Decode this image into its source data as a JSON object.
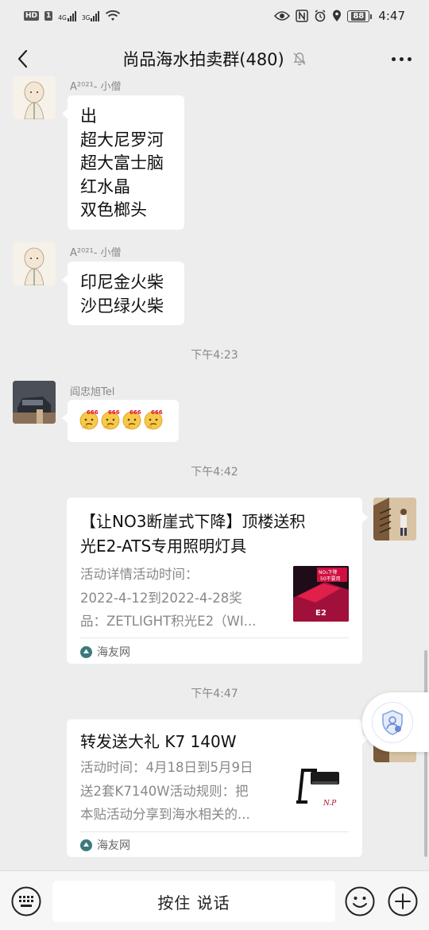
{
  "status_bar": {
    "left_badges": [
      "HD",
      "1"
    ],
    "signal1": "4G",
    "signal2": "3G",
    "battery": "88",
    "time": "4:47"
  },
  "header": {
    "title": "尚品海水拍卖群(480)",
    "back_icon": "chevron-left-icon",
    "mute_icon": "bell-muted-icon",
    "more_icon": "more-dots-icon"
  },
  "messages": [
    {
      "sender": "A²⁰²¹- 小僧",
      "lines": [
        "出",
        "超大尼罗河",
        "超大富士脑",
        "红水晶",
        "双色榔头"
      ]
    },
    {
      "sender": "A²⁰²¹- 小僧",
      "lines": [
        "印尼金火柴",
        "沙巴绿火柴"
      ]
    },
    {
      "timestamp": "下午4:23"
    },
    {
      "sender": "阎忠旭Tel",
      "emoji_text": [
        "666",
        "666",
        "666",
        "666"
      ]
    },
    {
      "timestamp": "下午4:42"
    },
    {
      "card": {
        "title_lines": [
          "【让NO3断崖式下降】顶楼送积",
          "光E2-ATS专用照明灯具"
        ],
        "desc_lines": [
          "活动详情活动时间：",
          "2022-4-12到2022-4-28奖",
          "品：ZETLIGHT积光E2（WI..."
        ],
        "thumb_text": [
          "NO₃下降",
          "50不要用",
          "E2"
        ],
        "source": "海友网"
      }
    },
    {
      "timestamp": "下午4:47"
    },
    {
      "card": {
        "title_lines": [
          "转发送大礼 K7 140W"
        ],
        "desc_lines": [
          "活动时间：4月18日到5月9日",
          "送2套K7140W活动规则：把",
          "本贴活动分享到海水相关的..."
        ],
        "thumb_text": [
          "N.P"
        ],
        "source": "海友网"
      }
    }
  ],
  "input_bar": {
    "keyboard_icon": "keyboard-icon",
    "hold_to_talk": "按住 说话",
    "emoji_icon": "smiley-icon",
    "plus_icon": "plus-circle-icon"
  },
  "colors": {
    "background": "#ededed",
    "bubble": "#ffffff",
    "meta_text": "#888888"
  }
}
